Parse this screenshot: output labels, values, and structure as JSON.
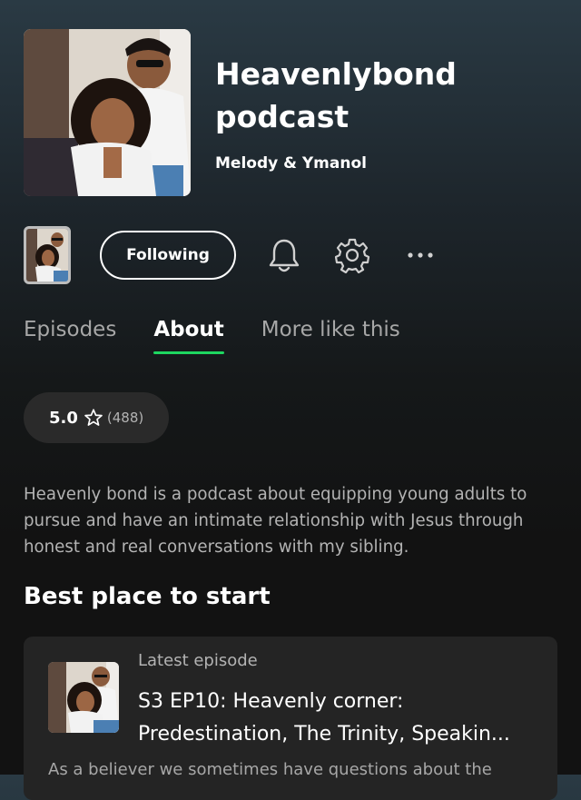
{
  "podcast": {
    "title": "Heavenlybond podcast",
    "author": "Melody & Ymanol"
  },
  "actions": {
    "follow_label": "Following",
    "bell_icon": "bell-icon",
    "gear_icon": "gear-icon",
    "more_icon": "more-icon"
  },
  "tabs": [
    {
      "label": "Episodes",
      "active": false
    },
    {
      "label": "About",
      "active": true
    },
    {
      "label": "More like this",
      "active": false
    }
  ],
  "rating": {
    "value": "5.0",
    "count": "(488)",
    "icon": "star-icon"
  },
  "description": "Heavenly bond is a podcast about equipping young adults to pursue and have an intimate relationship with Jesus through honest and real conversations with my sibling.",
  "section": {
    "title": "Best place to start"
  },
  "episode": {
    "label": "Latest episode",
    "title_line1": "S3 EP10: Heavenly corner:",
    "title_line2": "Predestination, The Trinity, Speakin...",
    "description": "As a believer we sometimes have questions about the"
  },
  "colors": {
    "accent": "#1ed760",
    "card": "#242424",
    "muted_text": "#b3b3b3"
  }
}
